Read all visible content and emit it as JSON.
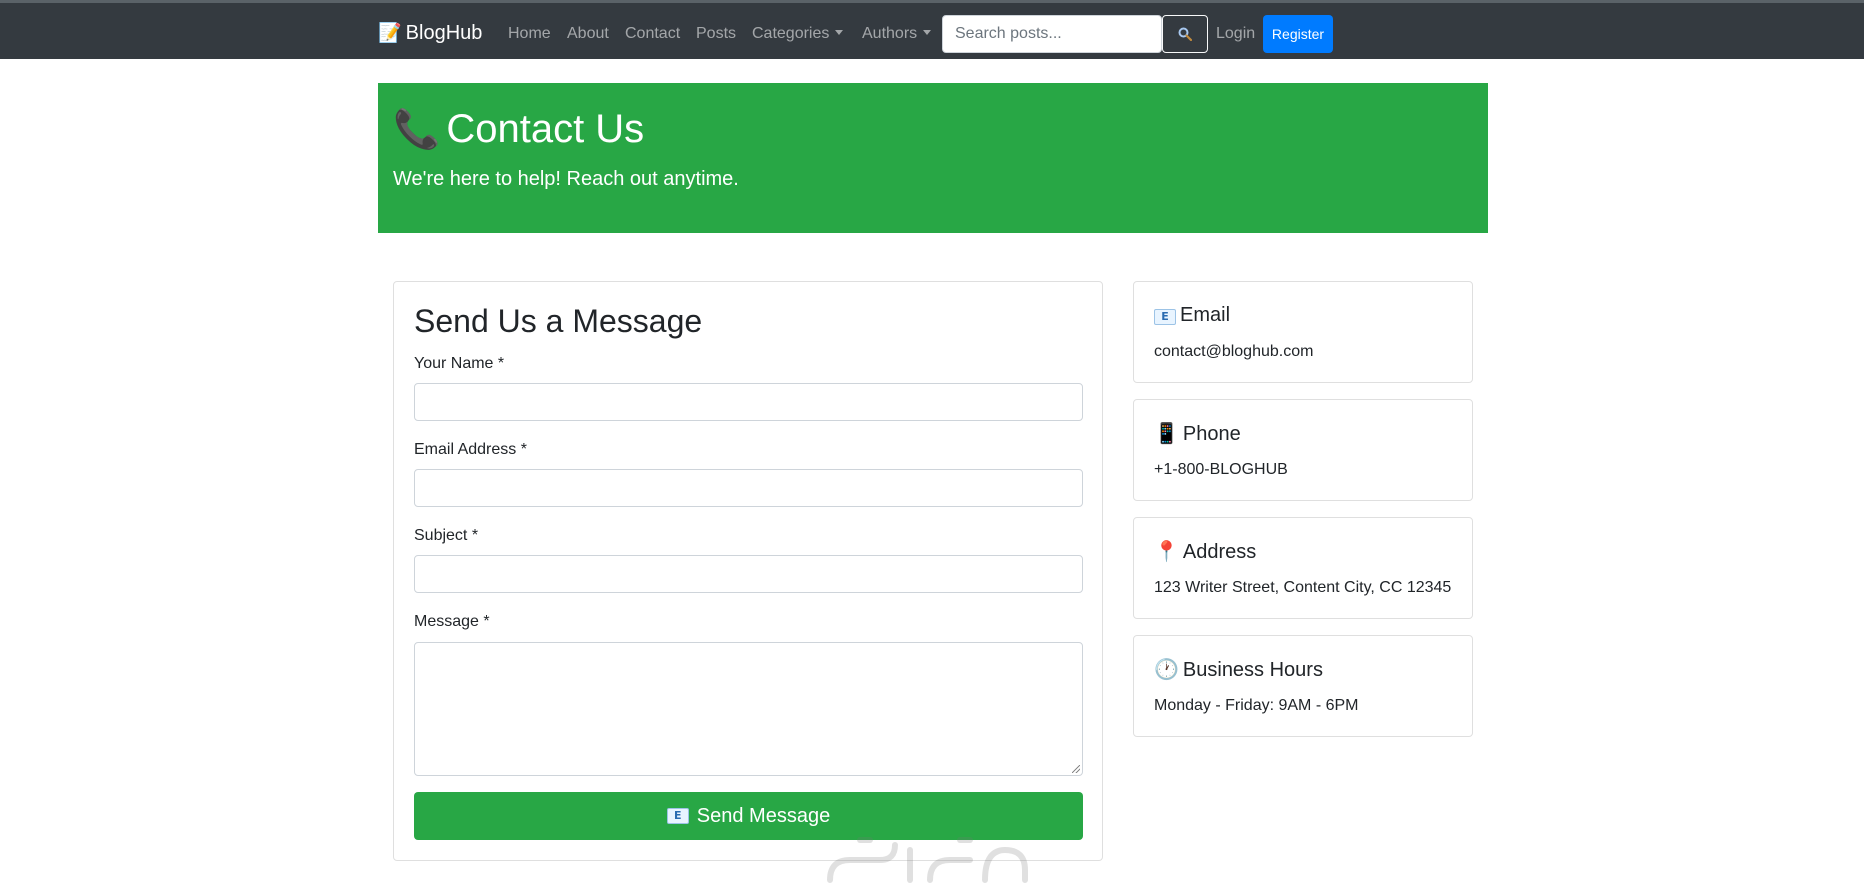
{
  "navbar": {
    "brand": "BlogHub",
    "brand_icon": "memo-icon",
    "links": {
      "home": "Home",
      "about": "About",
      "contact": "Contact",
      "posts": "Posts",
      "categories": "Categories",
      "authors": "Authors"
    },
    "search": {
      "placeholder": "Search posts...",
      "value": "",
      "button_icon": "search-icon"
    },
    "login": "Login",
    "register": "Register"
  },
  "hero": {
    "icon": "telephone-icon",
    "title": "Contact Us",
    "subtitle": "We're here to help! Reach out anytime."
  },
  "form": {
    "title": "Send Us a Message",
    "name_label": "Your Name *",
    "name_value": "",
    "email_label": "Email Address *",
    "email_value": "",
    "subject_label": "Subject *",
    "subject_value": "",
    "message_label": "Message *",
    "message_value": "",
    "submit_icon": "email-icon",
    "submit_label": "Send Message"
  },
  "info": {
    "email": {
      "icon": "email-icon",
      "title": "Email",
      "text": "contact@bloghub.com"
    },
    "phone": {
      "icon": "mobile-phone-icon",
      "title": "Phone",
      "text": "+1-800-BLOGHUB"
    },
    "address": {
      "icon": "pin-icon",
      "title": "Address",
      "text": "123 Writer Street, Content City, CC 12345"
    },
    "hours": {
      "icon": "clock-icon",
      "title": "Business Hours",
      "text": "Monday - Friday: 9AM - 6PM"
    }
  },
  "colors": {
    "navbar_bg": "#343a40",
    "hero_bg": "#28a745",
    "primary": "#007bff",
    "success": "#28a745"
  }
}
